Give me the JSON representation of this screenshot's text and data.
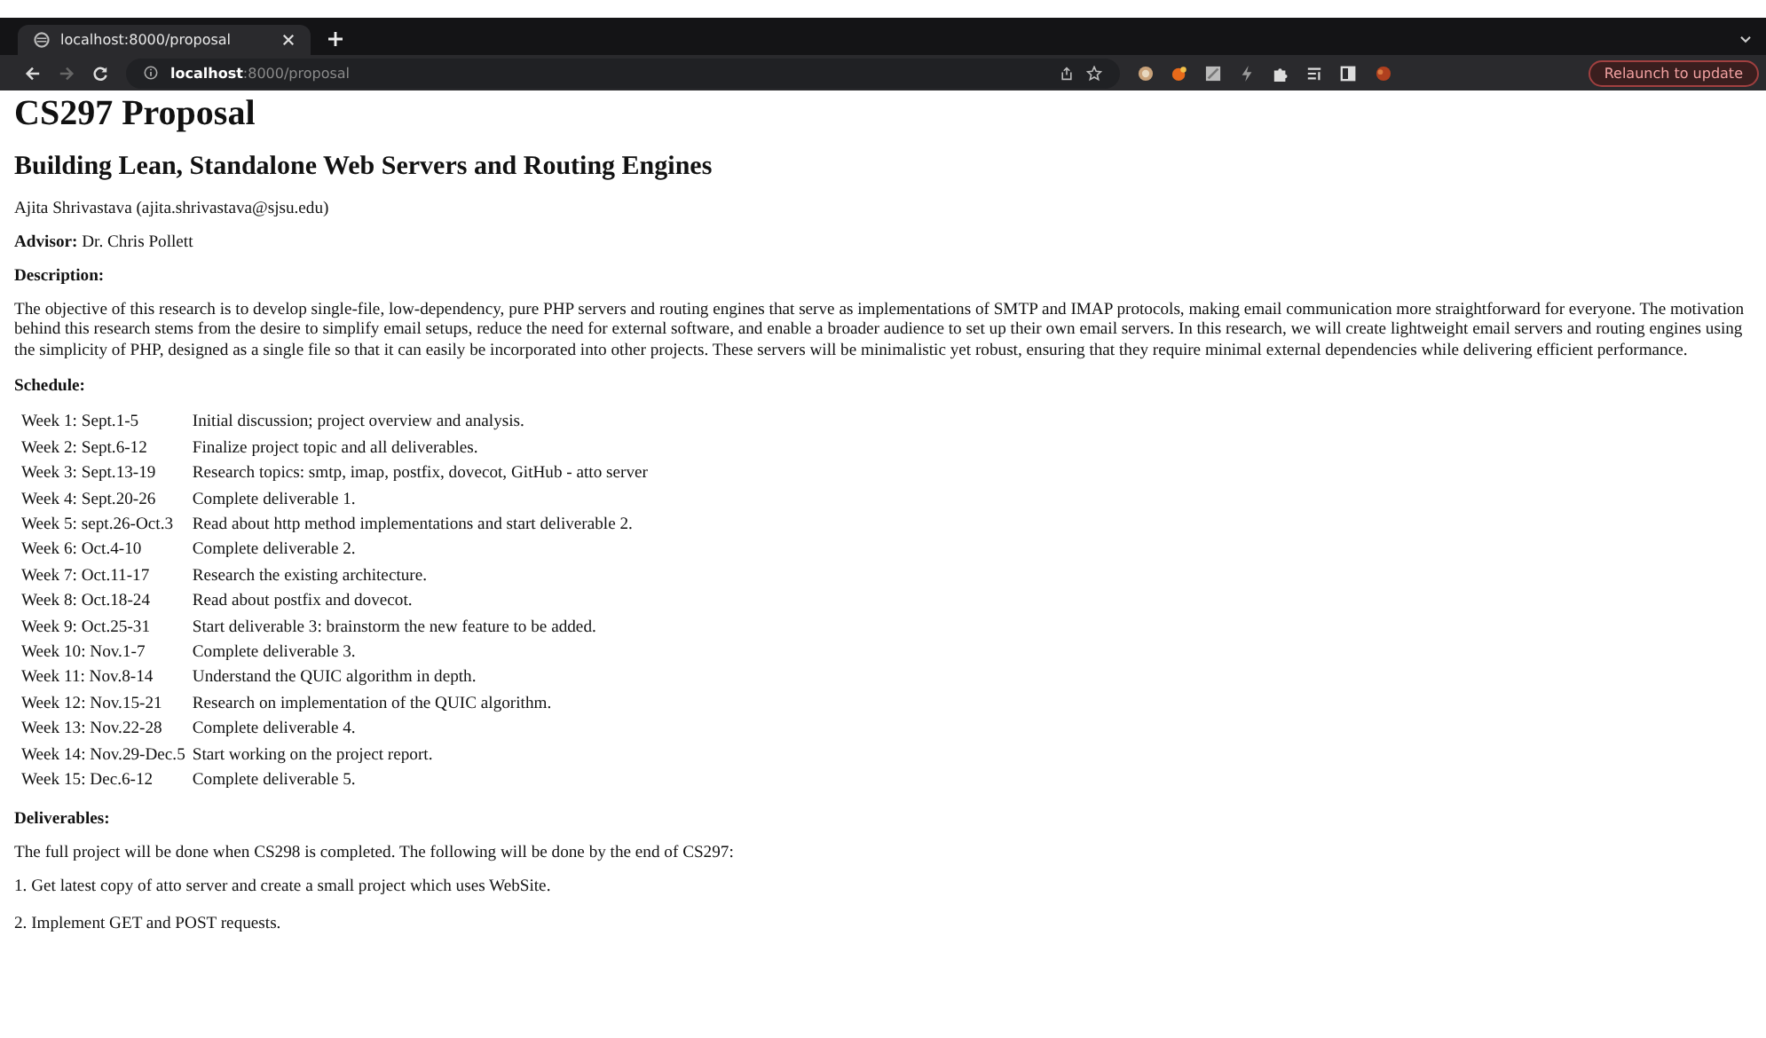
{
  "browser": {
    "tab": {
      "title": "localhost:8000/proposal",
      "selected": true
    },
    "address": {
      "host": "localhost",
      "path": ":8000/proposal"
    },
    "update_button": "Relaunch to update"
  },
  "page": {
    "title": "CS297 Proposal",
    "subtitle": "Building Lean, Standalone Web Servers and Routing Engines",
    "author": "Ajita Shrivastava (ajita.shrivastava@sjsu.edu)",
    "advisor": "**Advisor:** Dr. Chris Pollett",
    "description_heading": "Description:",
    "description": "The objective of this research is to develop single-file, low-dependency, pure PHP servers and routing engines that serve as implementations of SMTP and IMAP protocols, making email communication more straightforward for everyone. The motivation behind this research stems from the desire to simplify email setups, reduce the need for external software, and enable a broader audience to set up their own email servers. In this research, we will create lightweight email servers and routing engines using the simplicity of PHP, designed as a single file so that it can easily be incorporated into other projects. These servers will be minimalistic yet robust, ensuring that they require minimal external dependencies while delivering efficient performance.",
    "schedule_heading": "Schedule:",
    "schedule": [
      {
        "week": "Week 1: Sept.1-5",
        "task": "Initial discussion; project overview and analysis."
      },
      {
        "week": "Week 2: Sept.6-12",
        "task": "Finalize project topic and all deliverables."
      },
      {
        "week": "Week 3: Sept.13-19",
        "task": "Research topics: smtp, imap, postfix, dovecot, GitHub - atto server"
      },
      {
        "week": "Week 4: Sept.20-26",
        "task": "Complete deliverable 1."
      },
      {
        "week": "Week 5: sept.26-Oct.3",
        "task": "Read about http method implementations and start deliverable 2."
      },
      {
        "week": "Week 6: Oct.4-10",
        "task": "Complete deliverable 2."
      },
      {
        "week": "Week 7: Oct.11-17",
        "task": "Research the existing architecture."
      },
      {
        "week": "Week 8: Oct.18-24",
        "task": "Read about postfix and dovecot."
      },
      {
        "week": "Week 9: Oct.25-31",
        "task": "Start deliverable 3: brainstorm the new feature to be added."
      },
      {
        "week": "Week 10: Nov.1-7",
        "task": "Complete deliverable 3."
      },
      {
        "week": "Week 11: Nov.8-14",
        "task": "Understand the QUIC algorithm in depth."
      },
      {
        "week": "Week 12: Nov.15-21",
        "task": "Research on implementation of the QUIC algorithm."
      },
      {
        "week": "Week 13: Nov.22-28",
        "task": "Complete deliverable 4."
      },
      {
        "week": "Week 14: Nov.29-Dec.5",
        "task": "Start working on the project report."
      },
      {
        "week": "Week 15: Dec.6-12",
        "task": "Complete deliverable 5."
      }
    ],
    "deliverables_heading": "Deliverables:",
    "deliverables_intro": "The full project will be done when CS298 is completed. The following will be done by the end of CS297:",
    "deliverables": [
      "1. Get latest copy of atto server and create a small project which uses WebSite.",
      "2. Implement GET and POST requests."
    ]
  }
}
